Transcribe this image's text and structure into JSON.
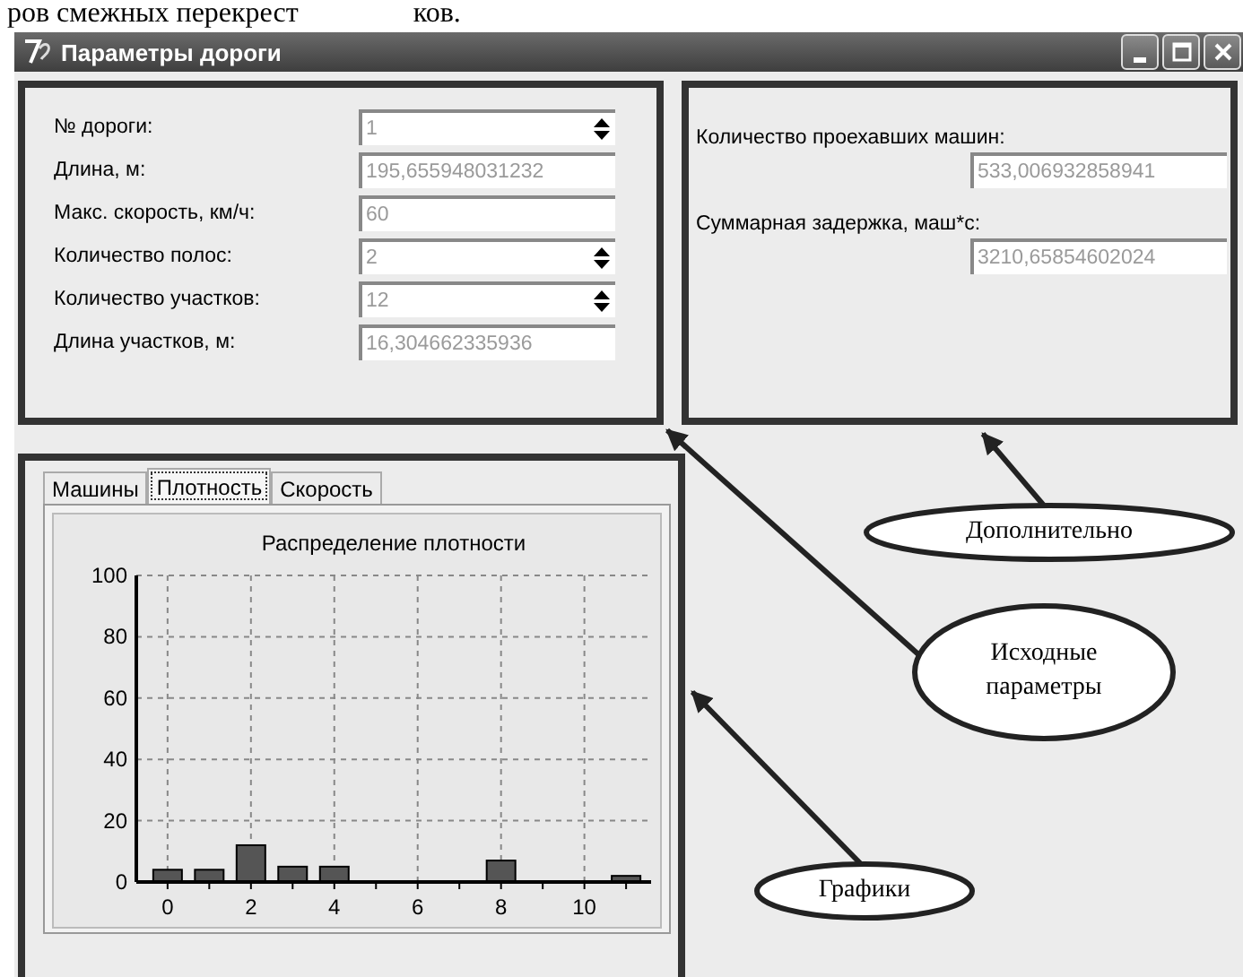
{
  "document_text": [
    "ров смежных перекрест",
    "ков."
  ],
  "window": {
    "title": "Параметры дороги",
    "buttons": [
      {
        "kind": "minimize"
      },
      {
        "kind": "maximize"
      },
      {
        "kind": "close"
      }
    ]
  },
  "initial_parameters": {
    "fields": [
      {
        "label": "№ дороги:",
        "value": "1",
        "kind": "spin",
        "disabled": true
      },
      {
        "label": "Длина, м:",
        "value": "195,655948031232",
        "kind": "text",
        "disabled": true
      },
      {
        "label": "Макс. скорость, км/ч:",
        "value": "60",
        "kind": "text",
        "disabled": true
      },
      {
        "label": "Количество полос:",
        "value": "2",
        "kind": "spin",
        "disabled": true
      },
      {
        "label": "Количество участков:",
        "value": "12",
        "kind": "spin",
        "disabled": true
      },
      {
        "label": "Длина участков, м:",
        "value": "16,304662335936",
        "kind": "text",
        "disabled": true
      }
    ]
  },
  "additional": {
    "fields": [
      {
        "label": "Количество проехавших машин:",
        "value": "533,006932858941",
        "disabled": true
      },
      {
        "label": "Суммарная задержка, маш*с:",
        "value": "3210,65854602024",
        "disabled": true
      }
    ]
  },
  "charts": {
    "tabs": [
      {
        "label": "Машины",
        "selected": false
      },
      {
        "label": "Плотность",
        "selected": true
      },
      {
        "label": "Скорость",
        "selected": false
      }
    ],
    "chart_data": {
      "type": "bar",
      "title": "Распределение плотности",
      "x": [
        0,
        1,
        2,
        3,
        4,
        5,
        6,
        7,
        8,
        9,
        10,
        11
      ],
      "series": [
        {
          "color": "#555555",
          "values": [
            4,
            4,
            12,
            5,
            5,
            0,
            0,
            0,
            7,
            0,
            0,
            2
          ]
        }
      ],
      "xlim": [
        -0.75,
        11.6
      ],
      "ylim": [
        0,
        100
      ],
      "yticks": [
        0,
        20,
        40,
        60,
        80,
        100
      ],
      "xticks": [
        0,
        2,
        4,
        6,
        8,
        10
      ],
      "grid": true
    }
  },
  "annotations": [
    {
      "text": "Дополнительно"
    },
    {
      "text": "Исходные параметры"
    },
    {
      "text": "Графики"
    }
  ]
}
